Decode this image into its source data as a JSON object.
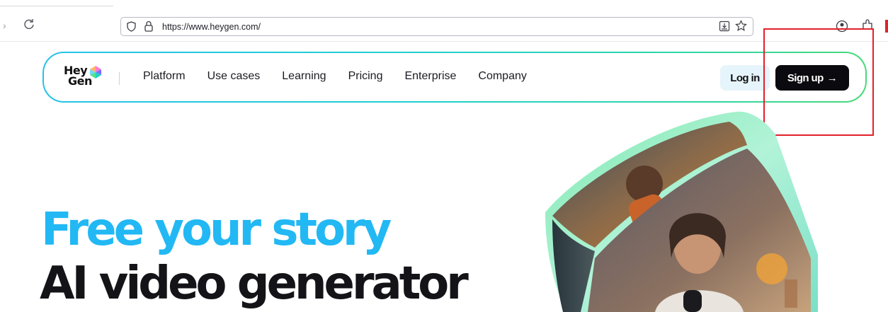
{
  "browser": {
    "url": "https://www.heygen.com/",
    "icons": [
      "forward-icon",
      "reload-icon",
      "shield-icon",
      "lock-icon",
      "reader-view-icon",
      "bookmark-star-icon",
      "account-icon",
      "extensions-icon"
    ]
  },
  "nav": {
    "logo_line1": "Hey",
    "logo_line2": "Gen",
    "links": [
      "Platform",
      "Use cases",
      "Learning",
      "Pricing",
      "Enterprise",
      "Company"
    ],
    "login_label": "Log in",
    "signup_label": "Sign up",
    "signup_arrow": "→"
  },
  "hero": {
    "line1": "Free your story",
    "line2": "AI video generator"
  },
  "colors": {
    "brand_blue": "#22b8f4",
    "nav_border_start": "#27c2e8",
    "nav_border_end": "#48d97a",
    "annotation_red": "#e2202a"
  }
}
